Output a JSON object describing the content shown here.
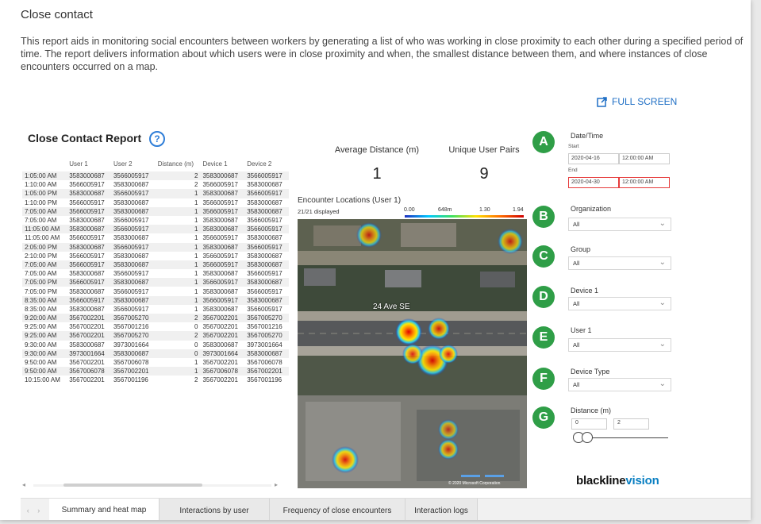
{
  "header": {
    "title": "Close contact",
    "description": "This report aids in monitoring social encounters between workers by generating a list of who was working in close proximity to each other during a specified period of time. The report delivers information about which users were in close proximity and when, the smallest distance between them, and where instances of close encounters occurred on a map.",
    "fullscreen_label": "FULL SCREEN"
  },
  "report": {
    "title": "Close Contact Report",
    "columns": [
      "",
      "User 1",
      "User 2",
      "Distance (m)",
      "Device 1",
      "Device 2"
    ],
    "rows": [
      [
        "1:05:00 AM",
        "3583000687",
        "3566005917",
        "2",
        "3583000687",
        "3566005917"
      ],
      [
        "1:10:00 AM",
        "3566005917",
        "3583000687",
        "2",
        "3566005917",
        "3583000687"
      ],
      [
        "1:05:00 PM",
        "3583000687",
        "3566005917",
        "1",
        "3583000687",
        "3566005917"
      ],
      [
        "1:10:00 PM",
        "3566005917",
        "3583000687",
        "1",
        "3566005917",
        "3583000687"
      ],
      [
        "7:05:00 AM",
        "3566005917",
        "3583000687",
        "1",
        "3566005917",
        "3583000687"
      ],
      [
        "7:05:00 AM",
        "3583000687",
        "3566005917",
        "1",
        "3583000687",
        "3566005917"
      ],
      [
        "11:05:00 AM",
        "3583000687",
        "3566005917",
        "1",
        "3583000687",
        "3566005917"
      ],
      [
        "11:05:00 AM",
        "3566005917",
        "3583000687",
        "1",
        "3566005917",
        "3583000687"
      ],
      [
        "2:05:00 PM",
        "3583000687",
        "3566005917",
        "1",
        "3583000687",
        "3566005917"
      ],
      [
        "2:10:00 PM",
        "3566005917",
        "3583000687",
        "1",
        "3566005917",
        "3583000687"
      ],
      [
        "7:05:00 AM",
        "3566005917",
        "3583000687",
        "1",
        "3566005917",
        "3583000687"
      ],
      [
        "7:05:00 AM",
        "3583000687",
        "3566005917",
        "1",
        "3583000687",
        "3566005917"
      ],
      [
        "7:05:00 PM",
        "3566005917",
        "3583000687",
        "1",
        "3566005917",
        "3583000687"
      ],
      [
        "7:05:00 PM",
        "3583000687",
        "3566005917",
        "1",
        "3583000687",
        "3566005917"
      ],
      [
        "8:35:00 AM",
        "3566005917",
        "3583000687",
        "1",
        "3566005917",
        "3583000687"
      ],
      [
        "8:35:00 AM",
        "3583000687",
        "3566005917",
        "1",
        "3583000687",
        "3566005917"
      ],
      [
        "9:20:00 AM",
        "3567002201",
        "3567005270",
        "2",
        "3567002201",
        "3567005270"
      ],
      [
        "9:25:00 AM",
        "3567002201",
        "3567001216",
        "0",
        "3567002201",
        "3567001216"
      ],
      [
        "9:25:00 AM",
        "3567002201",
        "3567005270",
        "2",
        "3567002201",
        "3567005270"
      ],
      [
        "9:30:00 AM",
        "3583000687",
        "3973001664",
        "0",
        "3583000687",
        "3973001664"
      ],
      [
        "9:30:00 AM",
        "3973001664",
        "3583000687",
        "0",
        "3973001664",
        "3583000687"
      ],
      [
        "9:50:00 AM",
        "3567002201",
        "3567006078",
        "1",
        "3567002201",
        "3567006078"
      ],
      [
        "9:50:00 AM",
        "3567006078",
        "3567002201",
        "1",
        "3567006078",
        "3567002201"
      ],
      [
        "10:15:00 AM",
        "3567002201",
        "3567001196",
        "2",
        "3567002201",
        "3567001196"
      ]
    ]
  },
  "metrics": {
    "avg_distance_label": "Average Distance (m)",
    "avg_distance_value": "1",
    "unique_pairs_label": "Unique User Pairs",
    "unique_pairs_value": "9"
  },
  "map": {
    "title": "Encounter Locations (User 1)",
    "displayed": "21/21 displayed",
    "scale_labels": [
      "0.00",
      "648m",
      "1.30",
      "1.94"
    ],
    "street_label": "24 Ave SE",
    "credit": "© 2020 Microsoft Corporation",
    "hotspot_intensities": [
      0.7,
      0.7,
      1.0,
      0.8,
      0.9,
      0.8,
      0.85,
      0.6,
      0.7,
      0.85
    ]
  },
  "filters": {
    "datetime_label": "Date/Time",
    "start_label": "Start",
    "start_date": "2020-04-16",
    "start_time": "12:00:00 AM",
    "end_label": "End",
    "end_date": "2020-04-30",
    "end_time": "12:00:00 AM",
    "organization_label": "Organization",
    "organization_value": "All",
    "group_label": "Group",
    "group_value": "All",
    "device1_label": "Device 1",
    "device1_value": "All",
    "user1_label": "User 1",
    "user1_value": "All",
    "device_type_label": "Device Type",
    "device_type_value": "All",
    "distance_label": "Distance (m)",
    "distance_min": "0",
    "distance_max": "2"
  },
  "markers": [
    "A",
    "B",
    "C",
    "D",
    "E",
    "F",
    "G"
  ],
  "brand": {
    "part1": "blackline",
    "part2": "vision"
  },
  "tabs": [
    "Summary and heat map",
    "Interactions by user",
    "Frequency of close encounters",
    "Interaction logs"
  ]
}
